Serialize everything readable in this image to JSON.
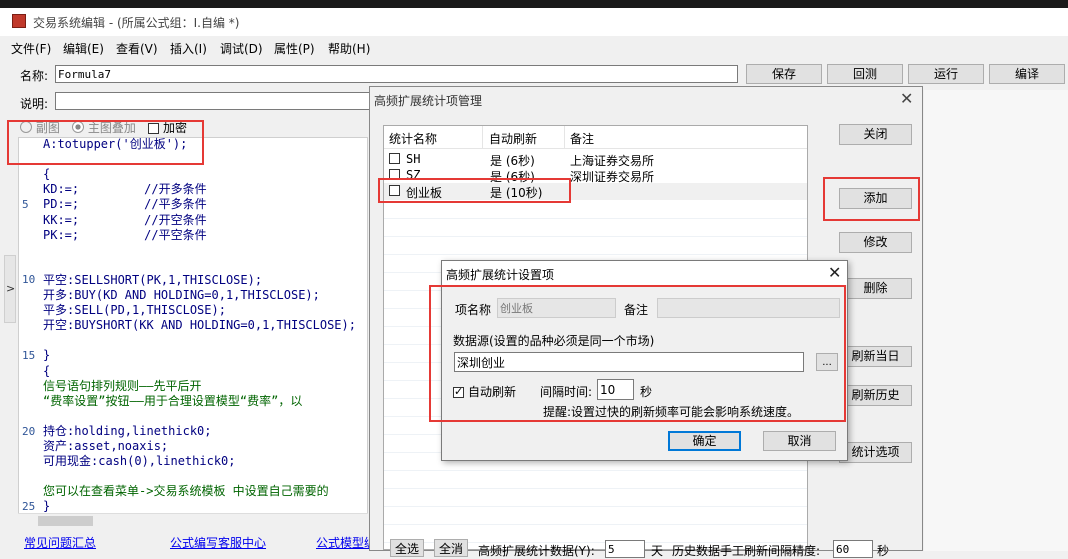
{
  "app": {
    "title": "交易系统编辑 - (所属公式组：I.自编 *)",
    "menu": [
      "文件(F)",
      "编辑(E)",
      "查看(V)",
      "插入(I)",
      "调试(D)",
      "属性(P)",
      "帮助(H)"
    ]
  },
  "form": {
    "name_label": "名称:",
    "name_value": "Formula7",
    "desc_label": "说明:",
    "buttons": {
      "save": "保存",
      "restore": "回测",
      "run": "运行",
      "compile": "编译"
    },
    "radio_sub": "副图",
    "radio_main": "主图叠加",
    "add_label": "加密"
  },
  "code": {
    "line_numbers": [
      "5",
      "10",
      "15",
      "20",
      "25"
    ],
    "lines": [
      {
        "text": "A:totupper('创业板');",
        "color": "#000080"
      },
      {
        "text": "",
        "color": "#000"
      },
      {
        "text": "{",
        "color": "#000080"
      },
      {
        "text": "KD:=;         //开多条件",
        "color": "#000080"
      },
      {
        "text": "PD:=;         //平多条件",
        "color": "#000080"
      },
      {
        "text": "KK:=;         //开空条件",
        "color": "#000080"
      },
      {
        "text": "PK:=;         //平空条件",
        "color": "#000080"
      },
      {
        "text": "",
        "color": "#000"
      },
      {
        "text": "",
        "color": "#000"
      },
      {
        "text": "平空:SELLSHORT(PK,1,THISCLOSE);",
        "color": "#000080"
      },
      {
        "text": "开多:BUY(KD AND HOLDING=0,1,THISCLOSE);",
        "color": "#000080"
      },
      {
        "text": "平多:SELL(PD,1,THISCLOSE);",
        "color": "#000080"
      },
      {
        "text": "开空:BUYSHORT(KK AND HOLDING=0,1,THISCLOSE);",
        "color": "#000080"
      },
      {
        "text": "",
        "color": "#000"
      },
      {
        "text": "}",
        "color": "#000080"
      },
      {
        "text": "{",
        "color": "#000080"
      },
      {
        "text": "信号语句排列规则——先平后开",
        "color": "#006400"
      },
      {
        "text": "“费率设置”按钮——用于合理设置模型“费率”，以",
        "color": "#006400"
      },
      {
        "text": "",
        "color": "#000"
      },
      {
        "text": "持仓:holding,linethick0;",
        "color": "#000080"
      },
      {
        "text": "资产:asset,noaxis;",
        "color": "#000080"
      },
      {
        "text": "可用现金:cash(0),linethick0;",
        "color": "#000080"
      },
      {
        "text": "",
        "color": "#000"
      },
      {
        "text": "您可以在查看菜单->交易系统模板 中设置自己需要的",
        "color": "#006400"
      },
      {
        "text": "}",
        "color": "#000080"
      }
    ]
  },
  "bottom_links": [
    "常见问题汇总",
    "公式编写客服中心",
    "公式模型编"
  ],
  "mgr": {
    "title": "高频扩展统计项管理",
    "columns": [
      "统计名称",
      "自动刷新",
      "备注"
    ],
    "rows": [
      {
        "name": "SH",
        "refresh": "是 (6秒)",
        "note": "上海证券交易所"
      },
      {
        "name": "SZ",
        "refresh": "是 (6秒)",
        "note": "深圳证券交易所"
      },
      {
        "name": "创业板",
        "refresh": "是 (10秒)",
        "note": ""
      }
    ],
    "buttons": {
      "close": "关闭",
      "add": "添加",
      "modify": "修改",
      "delete": "删除",
      "refresh_today": "刷新当日",
      "refresh_history": "刷新历史",
      "stat_options": "统计选项"
    },
    "footer": {
      "select_all": "全选",
      "deselect_all": "全消",
      "count_label": "高频扩展统计数据(Y):",
      "count_value": "5",
      "day_label": "天",
      "precision_label": "历史数据手工刷新间隔精度:",
      "precision_value": "60",
      "sec_label": "秒"
    }
  },
  "setup": {
    "title": "高频扩展统计设置项",
    "item_name_label": "项名称",
    "item_name_value": "创业板",
    "note_label": "备注",
    "datasource_label": "数据源(设置的品种必须是同一个市场)",
    "datasource_value": "深圳创业",
    "browse": "...",
    "auto_refresh_label": "自动刷新",
    "interval_label": "间隔时间:",
    "interval_value": "10",
    "interval_unit": "秒",
    "tip": "提醒:设置过快的刷新频率可能会影响系统速度。",
    "ok": "确定",
    "cancel": "取消"
  },
  "colors": {
    "highlight": "#e53935",
    "accent_blue": "#0078d7"
  }
}
